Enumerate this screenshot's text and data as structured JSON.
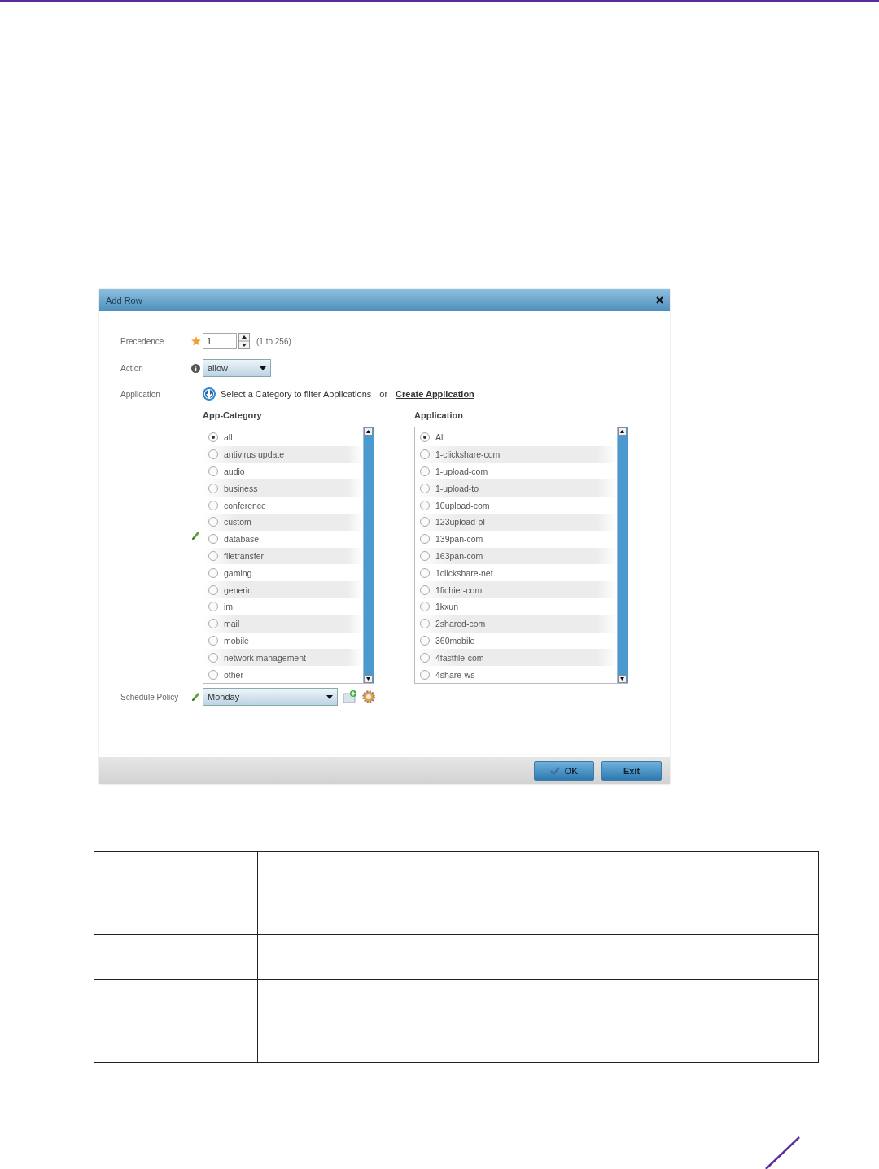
{
  "dialog": {
    "title": "Add Row",
    "precedence": {
      "label": "Precedence",
      "value": "1",
      "hint": "(1 to 256)"
    },
    "action": {
      "label": "Action",
      "value": "allow"
    },
    "application": {
      "label": "Application",
      "instruction": "Select a Category to filter Applications",
      "or": "or",
      "link": "Create Application"
    },
    "category_list": {
      "heading": "App-Category",
      "items": [
        {
          "label": "all",
          "selected": true
        },
        {
          "label": "antivirus update",
          "selected": false
        },
        {
          "label": "audio",
          "selected": false
        },
        {
          "label": "business",
          "selected": false
        },
        {
          "label": "conference",
          "selected": false
        },
        {
          "label": "custom",
          "selected": false
        },
        {
          "label": "database",
          "selected": false
        },
        {
          "label": "filetransfer",
          "selected": false
        },
        {
          "label": "gaming",
          "selected": false
        },
        {
          "label": "generic",
          "selected": false
        },
        {
          "label": "im",
          "selected": false
        },
        {
          "label": "mail",
          "selected": false
        },
        {
          "label": "mobile",
          "selected": false
        },
        {
          "label": "network management",
          "selected": false
        },
        {
          "label": "other",
          "selected": false
        }
      ]
    },
    "application_list": {
      "heading": "Application",
      "items": [
        {
          "label": "All",
          "selected": true
        },
        {
          "label": "1-clickshare-com",
          "selected": false
        },
        {
          "label": "1-upload-com",
          "selected": false
        },
        {
          "label": "1-upload-to",
          "selected": false
        },
        {
          "label": "10upload-com",
          "selected": false
        },
        {
          "label": "123upload-pl",
          "selected": false
        },
        {
          "label": "139pan-com",
          "selected": false
        },
        {
          "label": "163pan-com",
          "selected": false
        },
        {
          "label": "1clickshare-net",
          "selected": false
        },
        {
          "label": "1fichier-com",
          "selected": false
        },
        {
          "label": "1kxun",
          "selected": false
        },
        {
          "label": "2shared-com",
          "selected": false
        },
        {
          "label": "360mobile",
          "selected": false
        },
        {
          "label": "4fastfile-com",
          "selected": false
        },
        {
          "label": "4share-ws",
          "selected": false
        }
      ]
    },
    "schedule_policy": {
      "label": "Schedule Policy",
      "value": "Monday"
    },
    "buttons": [
      {
        "label": "OK",
        "kind": "ok"
      },
      {
        "label": "Exit",
        "kind": "exit"
      }
    ]
  }
}
